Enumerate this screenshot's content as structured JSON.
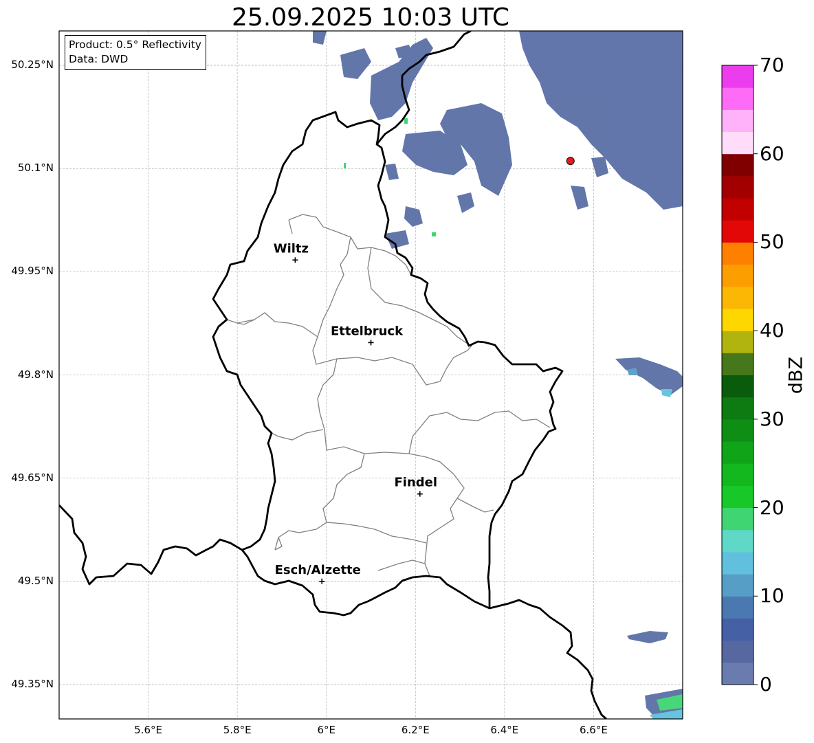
{
  "title": "25.09.2025 10:03 UTC",
  "info": {
    "product": "Product: 0.5° Reflectivity",
    "data": "Data: DWD"
  },
  "map": {
    "extent": {
      "lon_min": 5.4,
      "lon_max": 6.8,
      "lat_min": 49.3,
      "lat_max": 50.3
    },
    "lat_ticks": [
      {
        "value": 50.25,
        "label": "50.25°N"
      },
      {
        "value": 50.1,
        "label": "50.1°N"
      },
      {
        "value": 49.95,
        "label": "49.95°N"
      },
      {
        "value": 49.8,
        "label": "49.8°N"
      },
      {
        "value": 49.65,
        "label": "49.65°N"
      },
      {
        "value": 49.5,
        "label": "49.5°N"
      },
      {
        "value": 49.35,
        "label": "49.35°N"
      }
    ],
    "lon_ticks": [
      {
        "value": 5.6,
        "label": "5.6°E"
      },
      {
        "value": 5.8,
        "label": "5.8°E"
      },
      {
        "value": 6.0,
        "label": "6°E"
      },
      {
        "value": 6.2,
        "label": "6.2°E"
      },
      {
        "value": 6.4,
        "label": "6.4°E"
      },
      {
        "value": 6.6,
        "label": "6.6°E"
      }
    ],
    "cities": [
      {
        "name": "Wiltz",
        "lon": 5.93,
        "lat": 49.967
      },
      {
        "name": "Ettelbruck",
        "lon": 6.1,
        "lat": 49.847
      },
      {
        "name": "Findel",
        "lon": 6.21,
        "lat": 49.627
      },
      {
        "name": "Esch/Alzette",
        "lon": 5.99,
        "lat": 49.5
      }
    ],
    "radar_site": {
      "lon": 6.548,
      "lat": 50.111,
      "color": "#e41a1c"
    },
    "grid": true
  },
  "colorbar": {
    "label": "dBZ",
    "min": 0,
    "max": 70,
    "ticks": [
      "0",
      "10",
      "20",
      "30",
      "40",
      "50",
      "60",
      "70"
    ],
    "colors": [
      "#6a7bb0",
      "#56689f",
      "#4560a4",
      "#4b78b0",
      "#569ec6",
      "#61c0dd",
      "#5fd8c8",
      "#3ed572",
      "#18c828",
      "#12b81e",
      "#10a518",
      "#0f8e16",
      "#0d7a12",
      "#0a5c0d",
      "#46771a",
      "#b1b40f",
      "#ffd700",
      "#fcb705",
      "#fd9e00",
      "#ff7f00",
      "#e30808",
      "#c20000",
      "#a20000",
      "#800000",
      "#ffdcf9",
      "#ffb1fa",
      "#fe6bf6",
      "#eb3ded"
    ]
  }
}
